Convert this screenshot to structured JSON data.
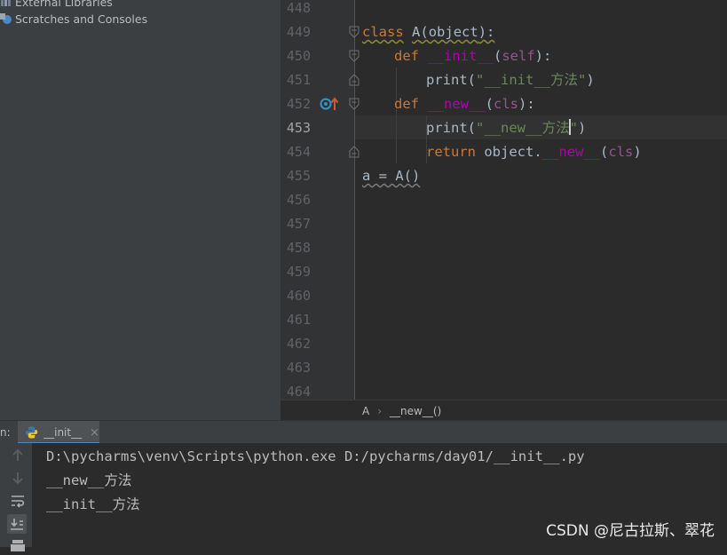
{
  "project_tree": {
    "items": [
      {
        "label": "External Libraries",
        "icon": "library-icon"
      },
      {
        "label": "Scratches and Consoles",
        "icon": "scratches-icon"
      }
    ]
  },
  "editor": {
    "line_numbers": [
      "448",
      "449",
      "450",
      "451",
      "452",
      "453",
      "454",
      "455",
      "456",
      "457",
      "458",
      "459",
      "460",
      "461",
      "462",
      "463",
      "464"
    ],
    "current_line": "453",
    "code": {
      "l449": {
        "kw": "class",
        "name": "A",
        "lp": "(",
        "base": "object",
        "rp": "):"
      },
      "l450": {
        "kw": "def",
        "fn": "__init__",
        "lp": "(",
        "param": "self",
        "rp": "):"
      },
      "l451": {
        "call": "print",
        "lp": "(",
        "str": "\"__init__方法\"",
        "rp": ")"
      },
      "l452": {
        "kw": "def",
        "fn": "__new__",
        "lp": "(",
        "param": "cls",
        "rp": "):"
      },
      "l453": {
        "call": "print",
        "lp": "(",
        "str_a": "\"__new__方法",
        "str_b": "\"",
        "rp": ")"
      },
      "l454": {
        "kw": "return",
        "obj": "object.",
        "fn": "__new__",
        "lp": "(",
        "param": "cls",
        "rp": ")"
      },
      "l455": {
        "text": "a = A()"
      }
    },
    "gutter_icon": "override-method-icon"
  },
  "breadcrumb": {
    "items": [
      "A",
      "__new__()"
    ],
    "separator": "›"
  },
  "run_panel": {
    "label": "n:",
    "tab_label": "__init__",
    "tab_icon": "python-icon",
    "output": [
      "D:\\pycharms\\venv\\Scripts\\python.exe D:/pycharms/day01/__init__.py",
      "__new__方法",
      "__init__方法"
    ],
    "toolbar": [
      "up-arrow-icon",
      "down-arrow-icon",
      "soft-wrap-icon",
      "scroll-to-end-icon",
      "print-icon"
    ]
  },
  "watermark": "CSDN @尼古拉斯、翠花",
  "colors": {
    "keyword": "#cc7832",
    "dunder": "#b200b2",
    "string": "#6a8759",
    "text": "#a9b7c6",
    "self": "#94558d"
  }
}
